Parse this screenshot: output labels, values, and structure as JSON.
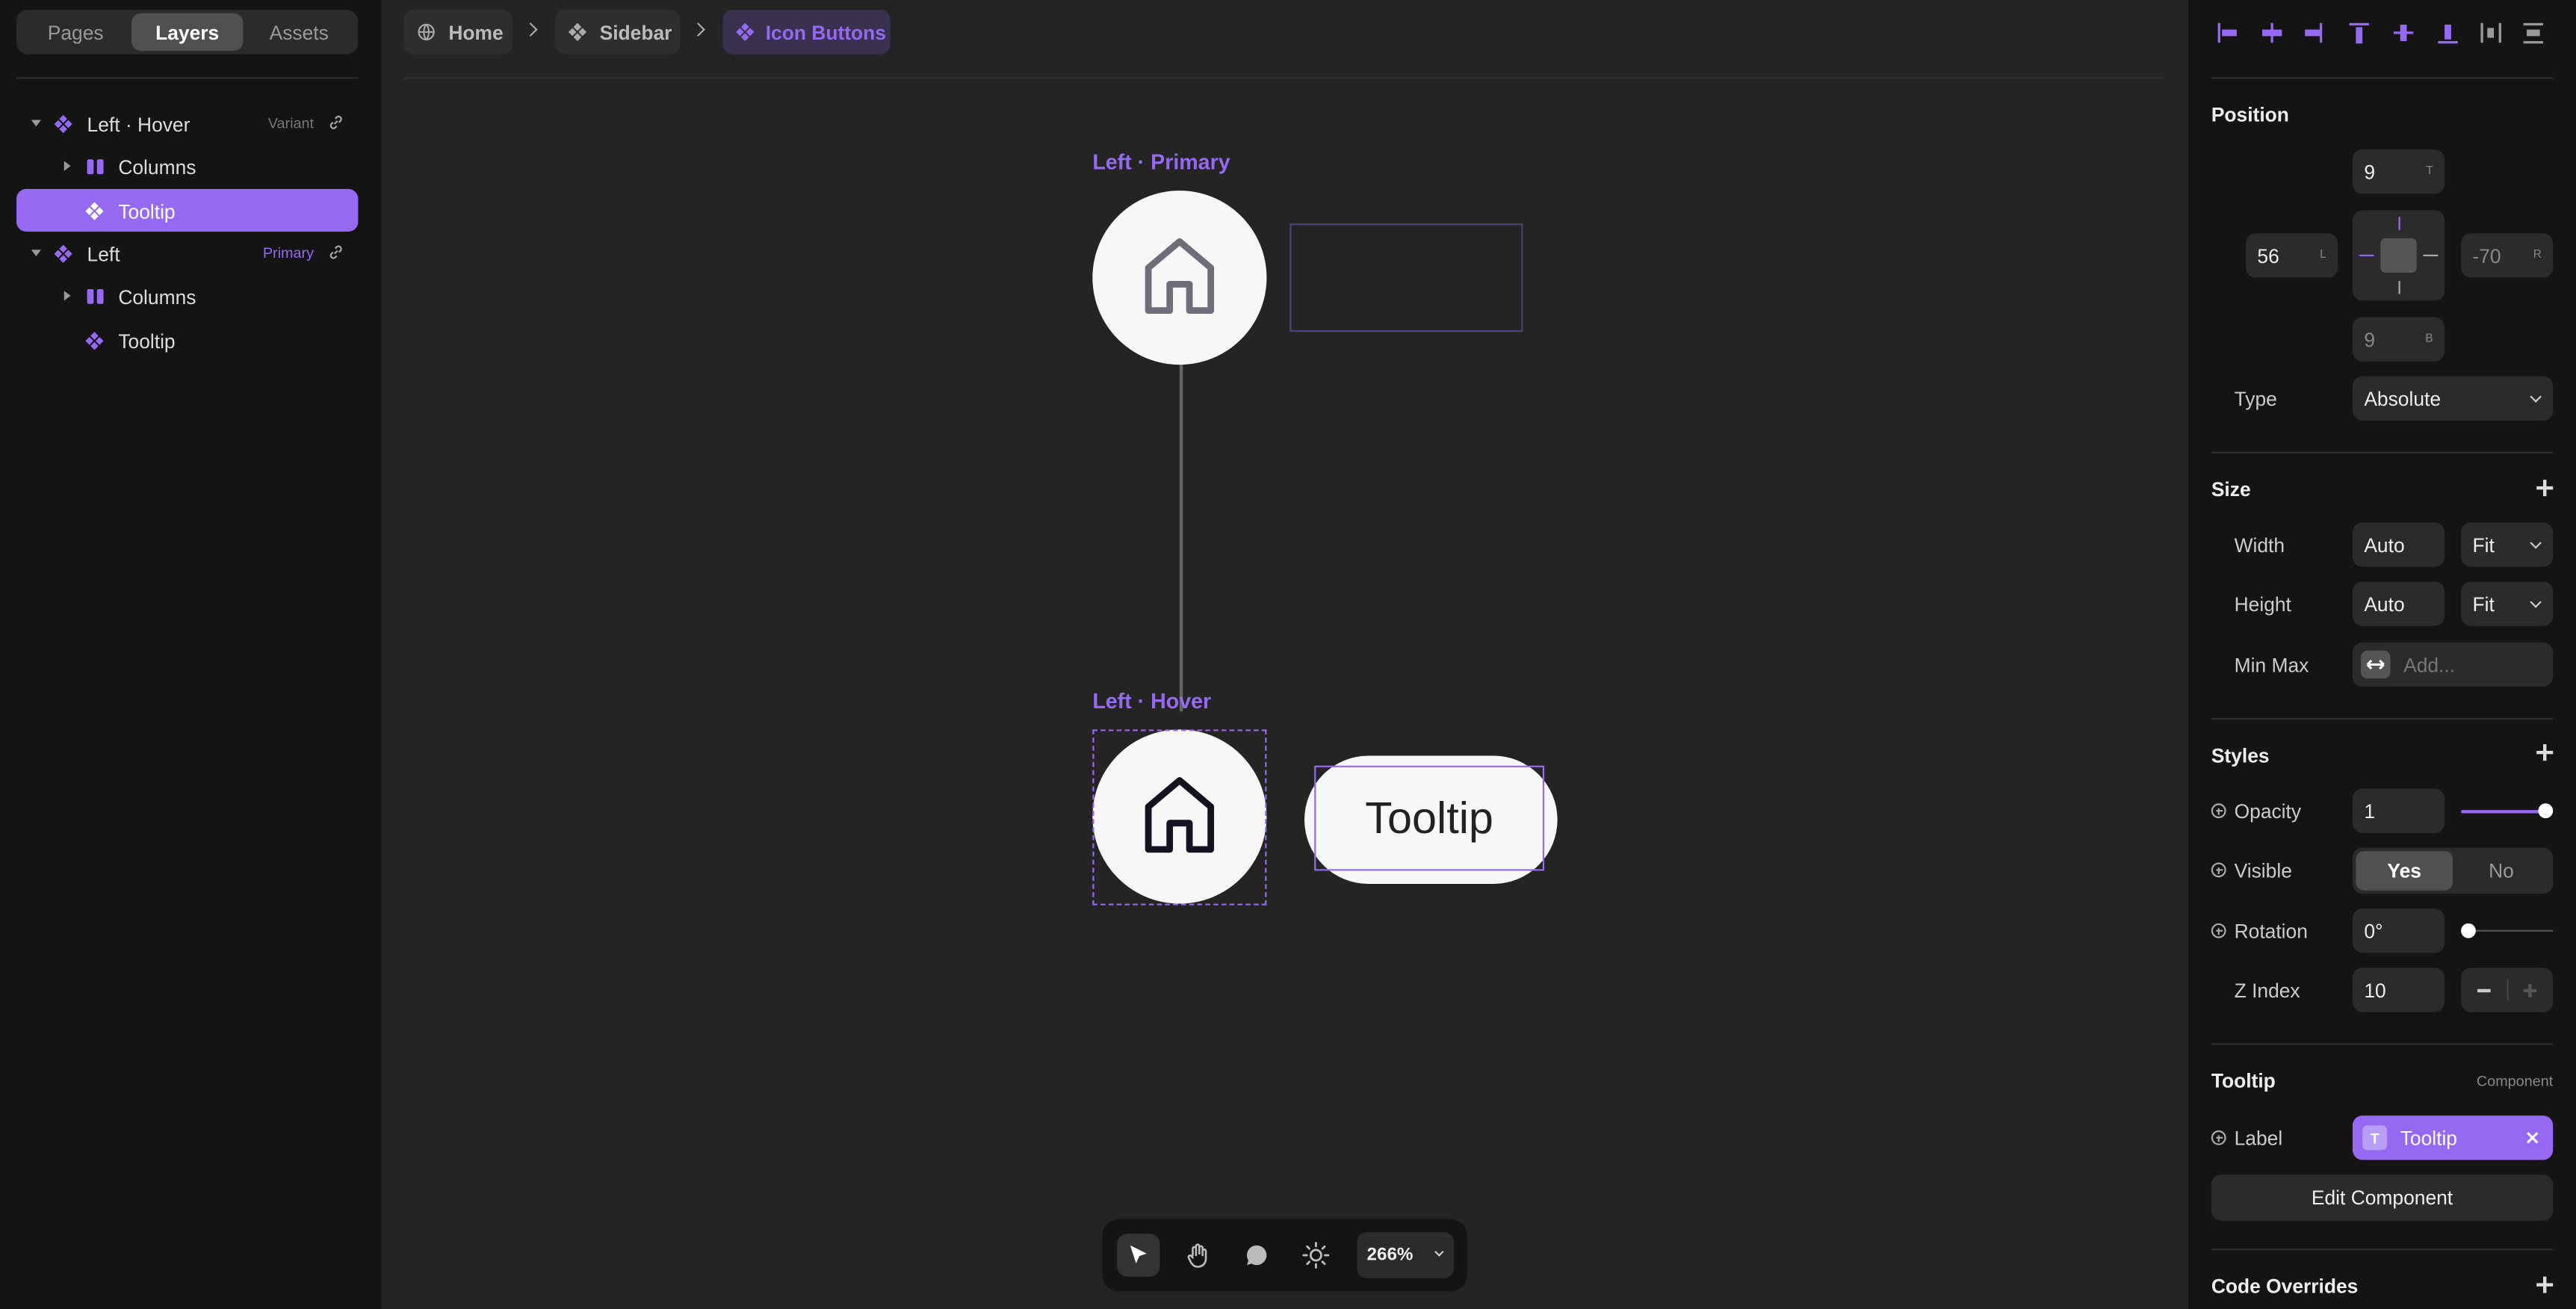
{
  "left_panel": {
    "tabs": [
      "Pages",
      "Layers",
      "Assets"
    ],
    "active_tab": "Layers",
    "layers": [
      {
        "name": "Left · Hover",
        "tag": "Variant",
        "icon": "component-icon",
        "expanded": true
      },
      {
        "name": "Columns",
        "icon": "columns-icon",
        "expanded": false
      },
      {
        "name": "Tooltip",
        "icon": "component-icon",
        "selected": true
      },
      {
        "name": "Left",
        "tag": "Primary",
        "icon": "component-icon",
        "expanded": true
      },
      {
        "name": "Columns",
        "icon": "columns-icon",
        "expanded": false
      },
      {
        "name": "Tooltip",
        "icon": "component-icon"
      }
    ]
  },
  "breadcrumbs": [
    {
      "label": "Home",
      "icon": "globe-icon"
    },
    {
      "label": "Sidebar",
      "icon": "component-icon"
    },
    {
      "label": "Icon Buttons",
      "icon": "component-icon",
      "active": true
    }
  ],
  "canvas": {
    "frame_primary_label": "Left · Primary",
    "frame_hover_label": "Left · Hover",
    "tooltip_text": "Tooltip"
  },
  "toolbar": {
    "tools": [
      "pointer-icon",
      "hand-icon",
      "comment-icon",
      "sun-icon"
    ],
    "active_tool": "pointer-icon",
    "zoom": "266%"
  },
  "right_panel": {
    "align_icons": [
      "align-left-icon",
      "align-center-h-icon",
      "align-right-icon",
      "align-top-icon",
      "align-center-v-icon",
      "align-bottom-icon",
      "distribute-h-icon",
      "distribute-v-icon"
    ],
    "position": {
      "title": "Position",
      "top": "9",
      "top_tag": "T",
      "left": "56",
      "left_tag": "L",
      "right": "-70",
      "right_tag": "R",
      "bottom": "9",
      "bottom_tag": "B",
      "type_label": "Type",
      "type_value": "Absolute"
    },
    "size": {
      "title": "Size",
      "width_label": "Width",
      "width_value": "Auto",
      "width_mode": "Fit",
      "height_label": "Height",
      "height_value": "Auto",
      "height_mode": "Fit",
      "minmax_label": "Min Max",
      "minmax_placeholder": "Add..."
    },
    "styles": {
      "title": "Styles",
      "opacity_label": "Opacity",
      "opacity_value": "1",
      "visible_label": "Visible",
      "visible_yes": "Yes",
      "visible_no": "No",
      "rotation_label": "Rotation",
      "rotation_value": "0°",
      "zindex_label": "Z Index",
      "zindex_value": "10"
    },
    "tooltip": {
      "title": "Tooltip",
      "subtitle": "Component",
      "label_label": "Label",
      "label_value": "Tooltip",
      "edit_button": "Edit Component"
    },
    "code_overrides": "Code Overrides"
  },
  "colors": {
    "accent": "#9669f2",
    "canvas": "#242424",
    "panel": "#141414"
  }
}
